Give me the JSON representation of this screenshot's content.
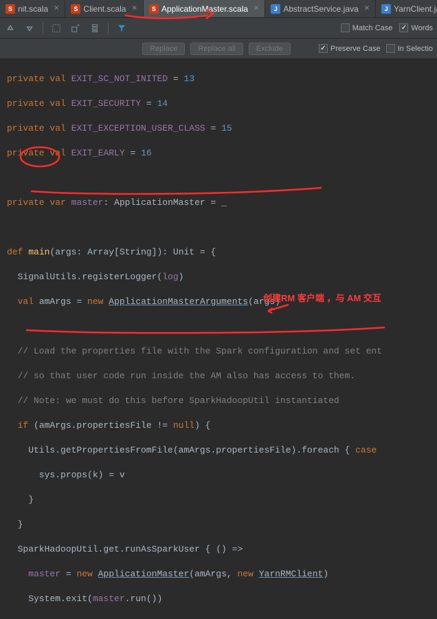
{
  "tabs": [
    {
      "name": "nit.scala",
      "kind": "scala",
      "active": false
    },
    {
      "name": "Client.scala",
      "kind": "scala",
      "active": false
    },
    {
      "name": "ApplicationMaster.scala",
      "kind": "scala",
      "active": true
    },
    {
      "name": "AbstractService.java",
      "kind": "java",
      "active": false
    },
    {
      "name": "YarnClient.jav",
      "kind": "java",
      "active": false
    }
  ],
  "findbar": {
    "matchCase": "Match Case",
    "words": "Words",
    "preserveCase": "Preserve Case",
    "inSelection": "In Selectio",
    "replace": "Replace",
    "replaceAll": "Replace all",
    "exclude": "Exclude"
  },
  "code": {
    "l01a": "private",
    "l01b": "val",
    "l01c": "EXIT_SC_NOT_INITED",
    "l01d": "=",
    "l01e": "13",
    "l02a": "private",
    "l02b": "val",
    "l02c": "EXIT_SECURITY",
    "l02d": "=",
    "l02e": "14",
    "l03a": "private",
    "l03b": "val",
    "l03c": "EXIT_EXCEPTION_USER_CLASS",
    "l03d": "=",
    "l03e": "15",
    "l04a": "private",
    "l04b": "val",
    "l04c": "EXIT_EARLY",
    "l04d": "=",
    "l04e": "16",
    "l06a": "private",
    "l06b": "var",
    "l06c": "master",
    "l06d": ": ",
    "l06e": "ApplicationMaster",
    "l06f": " = _",
    "l08a": "def",
    "l08b": "main",
    "l08c": "(",
    "l08d": "args",
    "l08e": ": Array[String]): Unit = {",
    "l09a": "  SignalUtils.registerLogger(",
    "l09b": "log",
    "l09c": ")",
    "l10a": "  ",
    "l10b": "val",
    "l10c": "amArgs",
    "l10d": " = ",
    "l10e": "new",
    "l10f": "ApplicationMasterArguments",
    "l10g": "(args)",
    "l12a": "  // Load the properties file with the Spark configuration and set ent",
    "l13a": "  // so that user code run inside the AM also has access to them.",
    "l14a": "  // Note: we must do this before SparkHadoopUtil instantiated",
    "l15a": "  ",
    "l15b": "if",
    "l15c": " (amArgs.propertiesFile != ",
    "l15d": "null",
    "l15e": ") {",
    "l16a": "    Utils.getPropertiesFromFile(amArgs.propertiesFile).foreach { ",
    "l16b": "case",
    "l17a": "      sys.props(k) = v",
    "l18a": "    }",
    "l19a": "  }",
    "l20a": "  SparkHadoopUtil.get.runAsSparkUser { () =>",
    "l21a": "    ",
    "l21b": "master",
    "l21c": " = ",
    "l21d": "new",
    "l21e": "ApplicationMaster",
    "l21f": "(amArgs, ",
    "l21g": "new",
    "l21h": "YarnRMClient",
    "l21i": ")",
    "l22a": "    System.exit(",
    "l22b": "master",
    "l22c": ".run())"
  },
  "annotation": "创建RM 客户端 ，与 AM 交互"
}
